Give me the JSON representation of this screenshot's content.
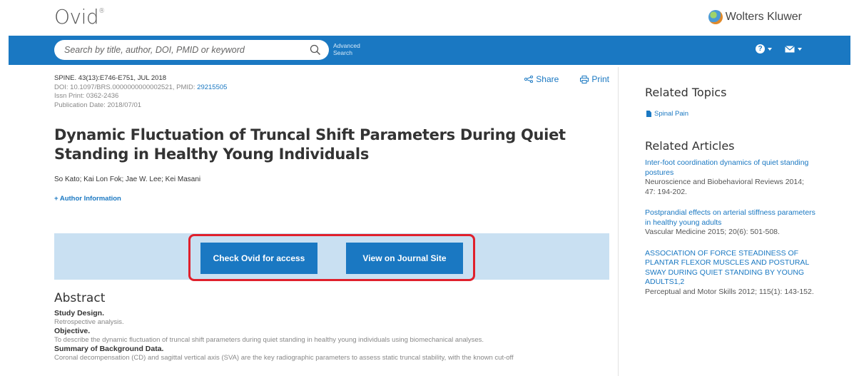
{
  "header": {
    "logo": "Ovid",
    "logo_mark": "®",
    "publisher": "Wolters Kluwer"
  },
  "search": {
    "placeholder": "Search by title, author, DOI, PMID or keyword",
    "advanced_line1": "Advanced",
    "advanced_line2": "Search"
  },
  "nav_icons": {
    "help": "question-circle-icon",
    "mail": "mail-icon"
  },
  "colors": {
    "brand_blue": "#1a78c2",
    "access_band": "#c9e0f2",
    "highlight_red": "#e0202c"
  },
  "article": {
    "citation": "SPINE. 43(13):E746-E751, JUL 2018",
    "doi_prefix": "DOI: 10.1097/BRS.0000000000002521,  PMID: ",
    "pmid": "29215505",
    "issn": "Issn Print: 0362-2436",
    "pub_date": "Publication Date: 2018/07/01",
    "share_label": "Share",
    "print_label": "Print",
    "title": "Dynamic Fluctuation of Truncal Shift Parameters During Quiet Standing in Healthy Young Individuals",
    "authors": "So Kato; Kai Lon Fok; Jae W. Lee; Kei Masani",
    "author_info": "+ Author Information"
  },
  "access": {
    "check_ovid": "Check Ovid for access",
    "journal_site": "View on Journal Site"
  },
  "abstract": {
    "heading": "Abstract",
    "sections": [
      {
        "label": "Study Design.",
        "text": "Retrospective analysis."
      },
      {
        "label": "Objective.",
        "text": "To describe the dynamic fluctuation of truncal shift parameters during quiet standing in healthy young individuals using biomechanical analyses."
      },
      {
        "label": "Summary of Background Data.",
        "text": "Coronal decompensation (CD) and sagittal vertical axis (SVA) are the key radiographic parameters to assess static truncal stability, with the known cut-off"
      }
    ]
  },
  "sidebar": {
    "related_topics_heading": "Related Topics",
    "topics": [
      "Spinal Pain"
    ],
    "related_articles_heading": "Related Articles",
    "articles": [
      {
        "title": "Inter-foot coordination dynamics of quiet standing postures",
        "source": "Neuroscience and Biobehavioral Reviews 2014; 47: 194-202."
      },
      {
        "title": "Postprandial effects on arterial stiffness parameters in healthy young adults",
        "source": "Vascular Medicine 2015; 20(6): 501-508."
      },
      {
        "title": "ASSOCIATION OF FORCE STEADINESS OF PLANTAR FLEXOR MUSCLES AND POSTURAL SWAY DURING QUIET STANDING BY YOUNG ADULTS1,2",
        "source": "Perceptual and Motor Skills 2012; 115(1): 143-152."
      }
    ]
  }
}
